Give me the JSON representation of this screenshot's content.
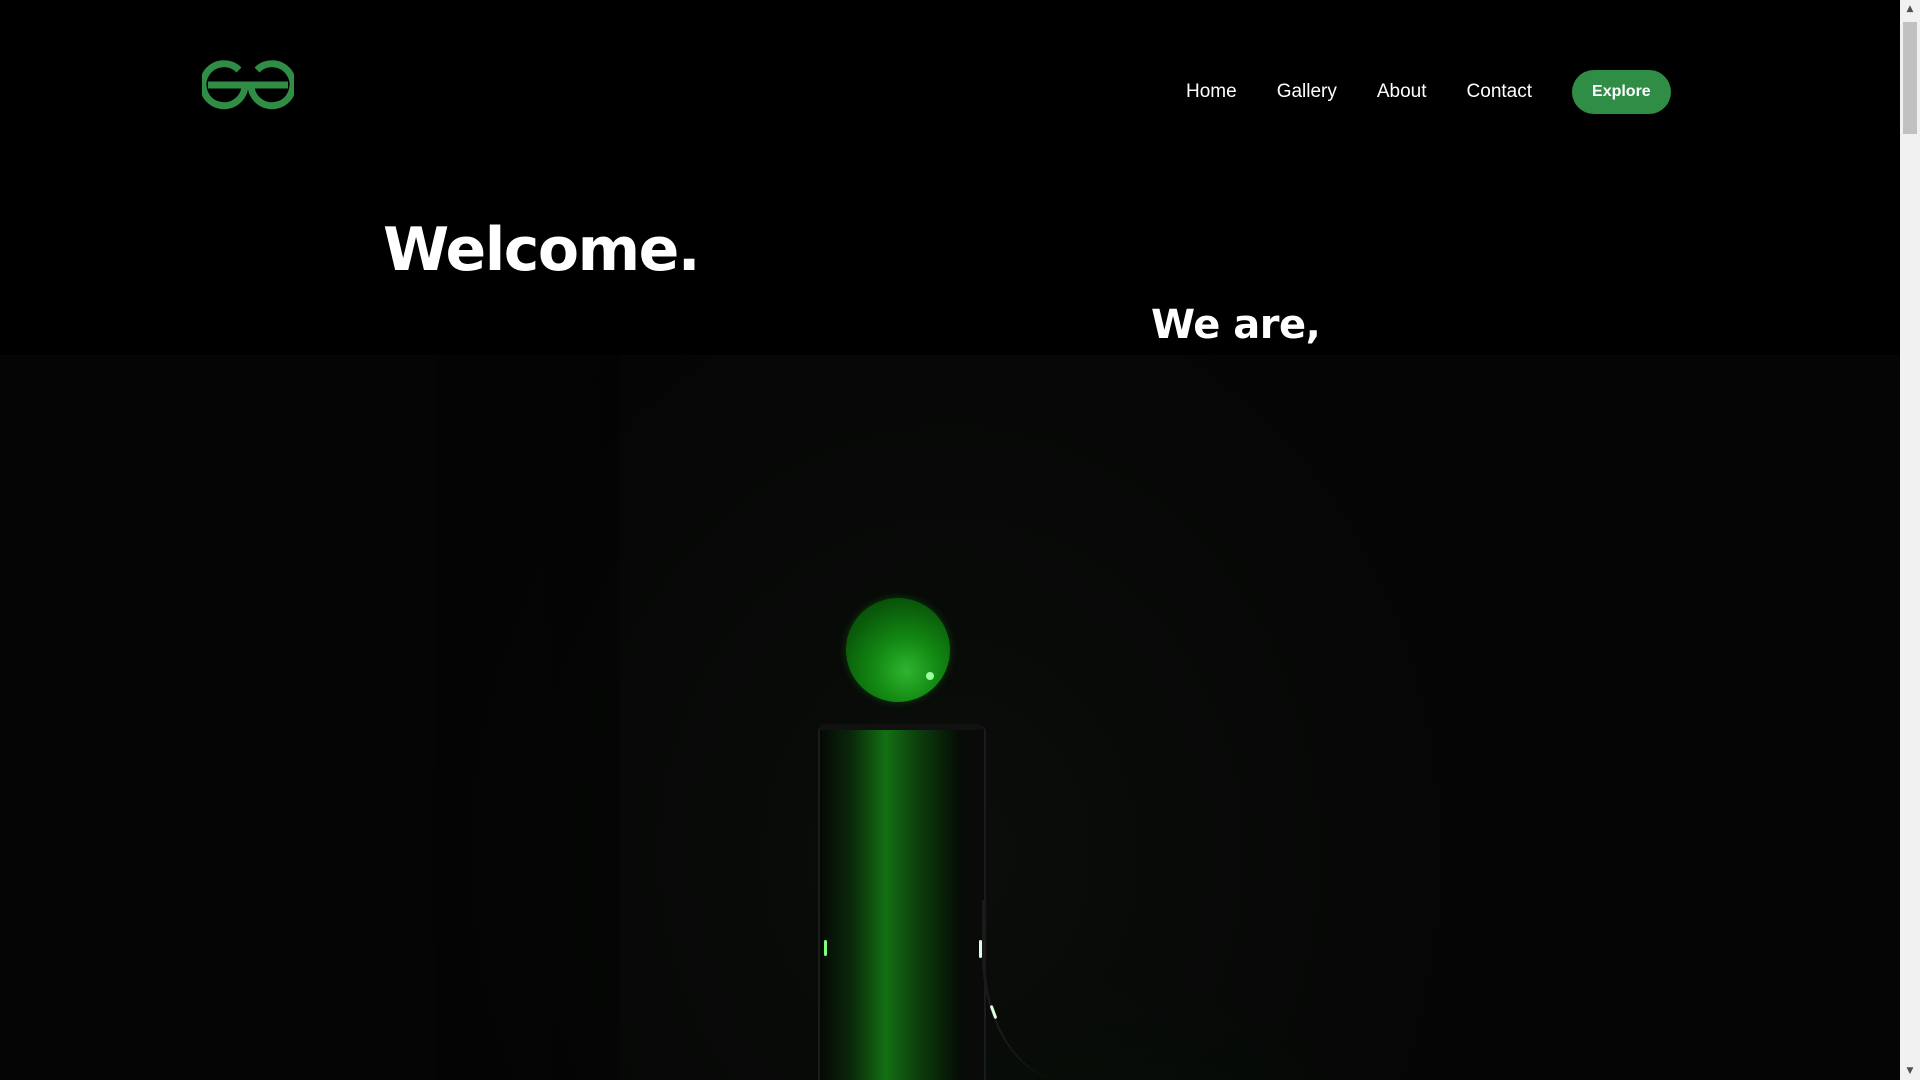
{
  "header": {
    "logo_alt": "GfG",
    "nav": [
      {
        "label": "Home"
      },
      {
        "label": "Gallery"
      },
      {
        "label": "About"
      },
      {
        "label": "Contact"
      }
    ],
    "explore_label": "Explore"
  },
  "hero": {
    "title": "Welcome.",
    "subtitle": "We are,"
  },
  "colors": {
    "accent": "#2f8d46",
    "background": "#000000",
    "glow": "#0e6e14"
  },
  "icons": {
    "logo": "gfg-logo-icon",
    "scroll_up": "scroll-up-arrow-icon",
    "scroll_down": "scroll-down-arrow-icon"
  }
}
